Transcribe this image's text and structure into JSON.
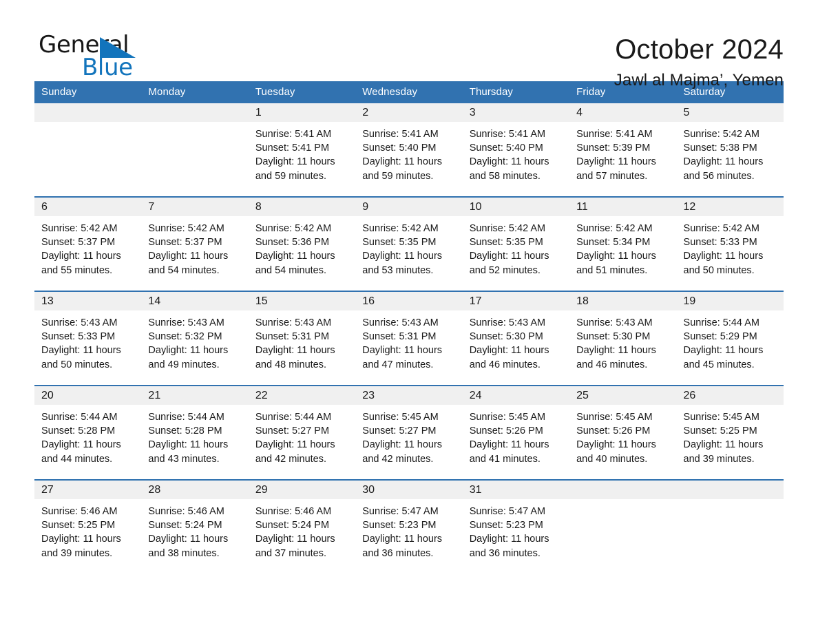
{
  "brand": {
    "logo_text_top": "General",
    "logo_text_bottom": "Blue",
    "logo_triangle_icon": "triangle-icon",
    "color_blue": "#1274bc"
  },
  "header": {
    "title": "October 2024",
    "subtitle": "Jawl al Majma’, Yemen"
  },
  "theme": {
    "header_bar": "#3172b0",
    "day_band": "#f0f0f0",
    "rule": "#3172b0",
    "text": "#1a1a1a"
  },
  "calendar": {
    "weekday_headers": [
      "Sunday",
      "Monday",
      "Tuesday",
      "Wednesday",
      "Thursday",
      "Friday",
      "Saturday"
    ],
    "weeks": [
      [
        {
          "day": "",
          "empty": true
        },
        {
          "day": "",
          "empty": true
        },
        {
          "day": "1",
          "sunrise": "Sunrise: 5:41 AM",
          "sunset": "Sunset: 5:41 PM",
          "daylight": "Daylight: 11 hours and 59 minutes."
        },
        {
          "day": "2",
          "sunrise": "Sunrise: 5:41 AM",
          "sunset": "Sunset: 5:40 PM",
          "daylight": "Daylight: 11 hours and 59 minutes."
        },
        {
          "day": "3",
          "sunrise": "Sunrise: 5:41 AM",
          "sunset": "Sunset: 5:40 PM",
          "daylight": "Daylight: 11 hours and 58 minutes."
        },
        {
          "day": "4",
          "sunrise": "Sunrise: 5:41 AM",
          "sunset": "Sunset: 5:39 PM",
          "daylight": "Daylight: 11 hours and 57 minutes."
        },
        {
          "day": "5",
          "sunrise": "Sunrise: 5:42 AM",
          "sunset": "Sunset: 5:38 PM",
          "daylight": "Daylight: 11 hours and 56 minutes."
        }
      ],
      [
        {
          "day": "6",
          "sunrise": "Sunrise: 5:42 AM",
          "sunset": "Sunset: 5:37 PM",
          "daylight": "Daylight: 11 hours and 55 minutes."
        },
        {
          "day": "7",
          "sunrise": "Sunrise: 5:42 AM",
          "sunset": "Sunset: 5:37 PM",
          "daylight": "Daylight: 11 hours and 54 minutes."
        },
        {
          "day": "8",
          "sunrise": "Sunrise: 5:42 AM",
          "sunset": "Sunset: 5:36 PM",
          "daylight": "Daylight: 11 hours and 54 minutes."
        },
        {
          "day": "9",
          "sunrise": "Sunrise: 5:42 AM",
          "sunset": "Sunset: 5:35 PM",
          "daylight": "Daylight: 11 hours and 53 minutes."
        },
        {
          "day": "10",
          "sunrise": "Sunrise: 5:42 AM",
          "sunset": "Sunset: 5:35 PM",
          "daylight": "Daylight: 11 hours and 52 minutes."
        },
        {
          "day": "11",
          "sunrise": "Sunrise: 5:42 AM",
          "sunset": "Sunset: 5:34 PM",
          "daylight": "Daylight: 11 hours and 51 minutes."
        },
        {
          "day": "12",
          "sunrise": "Sunrise: 5:42 AM",
          "sunset": "Sunset: 5:33 PM",
          "daylight": "Daylight: 11 hours and 50 minutes."
        }
      ],
      [
        {
          "day": "13",
          "sunrise": "Sunrise: 5:43 AM",
          "sunset": "Sunset: 5:33 PM",
          "daylight": "Daylight: 11 hours and 50 minutes."
        },
        {
          "day": "14",
          "sunrise": "Sunrise: 5:43 AM",
          "sunset": "Sunset: 5:32 PM",
          "daylight": "Daylight: 11 hours and 49 minutes."
        },
        {
          "day": "15",
          "sunrise": "Sunrise: 5:43 AM",
          "sunset": "Sunset: 5:31 PM",
          "daylight": "Daylight: 11 hours and 48 minutes."
        },
        {
          "day": "16",
          "sunrise": "Sunrise: 5:43 AM",
          "sunset": "Sunset: 5:31 PM",
          "daylight": "Daylight: 11 hours and 47 minutes."
        },
        {
          "day": "17",
          "sunrise": "Sunrise: 5:43 AM",
          "sunset": "Sunset: 5:30 PM",
          "daylight": "Daylight: 11 hours and 46 minutes."
        },
        {
          "day": "18",
          "sunrise": "Sunrise: 5:43 AM",
          "sunset": "Sunset: 5:30 PM",
          "daylight": "Daylight: 11 hours and 46 minutes."
        },
        {
          "day": "19",
          "sunrise": "Sunrise: 5:44 AM",
          "sunset": "Sunset: 5:29 PM",
          "daylight": "Daylight: 11 hours and 45 minutes."
        }
      ],
      [
        {
          "day": "20",
          "sunrise": "Sunrise: 5:44 AM",
          "sunset": "Sunset: 5:28 PM",
          "daylight": "Daylight: 11 hours and 44 minutes."
        },
        {
          "day": "21",
          "sunrise": "Sunrise: 5:44 AM",
          "sunset": "Sunset: 5:28 PM",
          "daylight": "Daylight: 11 hours and 43 minutes."
        },
        {
          "day": "22",
          "sunrise": "Sunrise: 5:44 AM",
          "sunset": "Sunset: 5:27 PM",
          "daylight": "Daylight: 11 hours and 42 minutes."
        },
        {
          "day": "23",
          "sunrise": "Sunrise: 5:45 AM",
          "sunset": "Sunset: 5:27 PM",
          "daylight": "Daylight: 11 hours and 42 minutes."
        },
        {
          "day": "24",
          "sunrise": "Sunrise: 5:45 AM",
          "sunset": "Sunset: 5:26 PM",
          "daylight": "Daylight: 11 hours and 41 minutes."
        },
        {
          "day": "25",
          "sunrise": "Sunrise: 5:45 AM",
          "sunset": "Sunset: 5:26 PM",
          "daylight": "Daylight: 11 hours and 40 minutes."
        },
        {
          "day": "26",
          "sunrise": "Sunrise: 5:45 AM",
          "sunset": "Sunset: 5:25 PM",
          "daylight": "Daylight: 11 hours and 39 minutes."
        }
      ],
      [
        {
          "day": "27",
          "sunrise": "Sunrise: 5:46 AM",
          "sunset": "Sunset: 5:25 PM",
          "daylight": "Daylight: 11 hours and 39 minutes."
        },
        {
          "day": "28",
          "sunrise": "Sunrise: 5:46 AM",
          "sunset": "Sunset: 5:24 PM",
          "daylight": "Daylight: 11 hours and 38 minutes."
        },
        {
          "day": "29",
          "sunrise": "Sunrise: 5:46 AM",
          "sunset": "Sunset: 5:24 PM",
          "daylight": "Daylight: 11 hours and 37 minutes."
        },
        {
          "day": "30",
          "sunrise": "Sunrise: 5:47 AM",
          "sunset": "Sunset: 5:23 PM",
          "daylight": "Daylight: 11 hours and 36 minutes."
        },
        {
          "day": "31",
          "sunrise": "Sunrise: 5:47 AM",
          "sunset": "Sunset: 5:23 PM",
          "daylight": "Daylight: 11 hours and 36 minutes."
        },
        {
          "day": "",
          "empty": true
        },
        {
          "day": "",
          "empty": true
        }
      ]
    ]
  }
}
